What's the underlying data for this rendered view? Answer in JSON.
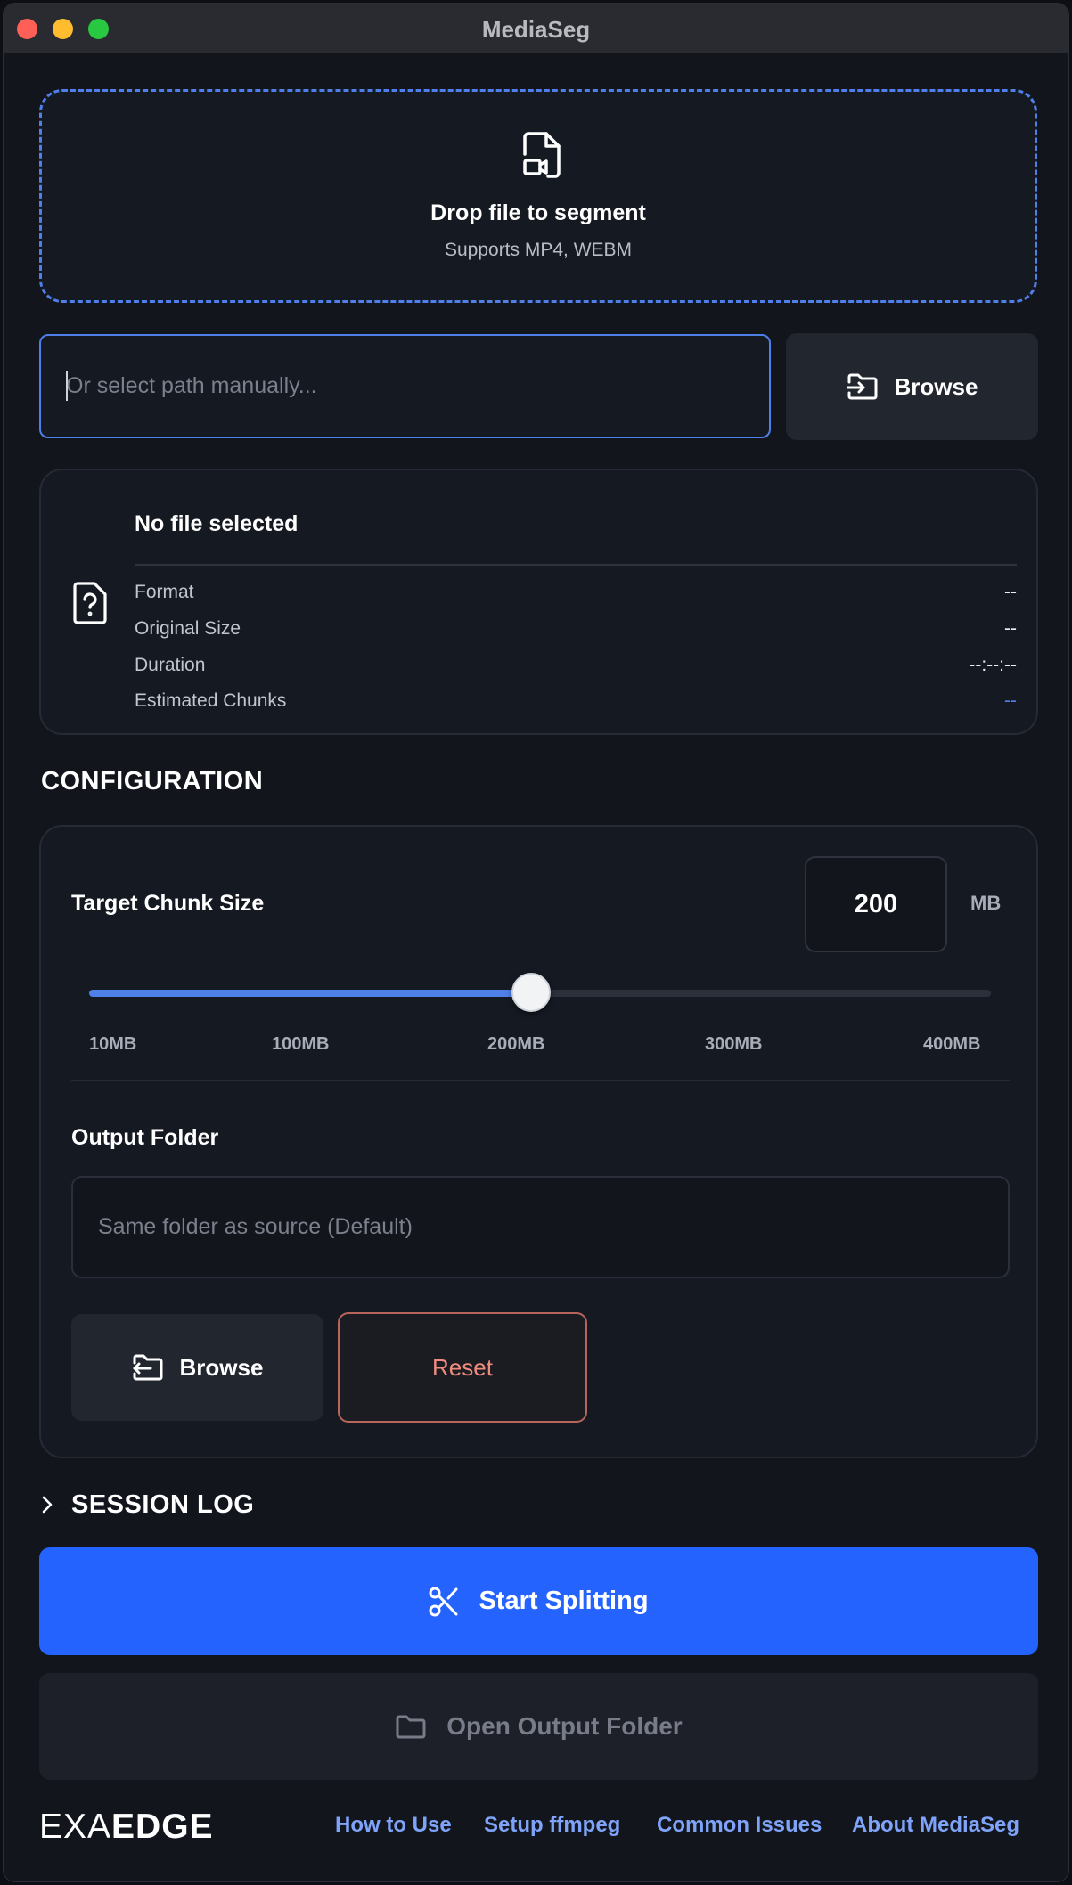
{
  "window": {
    "title": "MediaSeg"
  },
  "dropzone": {
    "title": "Drop file to segment",
    "subtitle": "Supports MP4, WEBM",
    "icon": "file-video-icon"
  },
  "path": {
    "placeholder": "Or select path manually...",
    "value": "",
    "browse_label": "Browse"
  },
  "file_info": {
    "title": "No file selected",
    "icon": "file-question-icon",
    "rows": [
      {
        "label": "Format",
        "value": "--"
      },
      {
        "label": "Original Size",
        "value": "--"
      },
      {
        "label": "Duration",
        "value": "--:--:--"
      },
      {
        "label": "Estimated Chunks",
        "value": "--"
      }
    ]
  },
  "configuration": {
    "title": "CONFIGURATION",
    "chunk_size": {
      "label": "Target Chunk Size",
      "value": "200",
      "unit": "MB",
      "slider": {
        "min_mb": 10,
        "max_mb": 400,
        "value_mb": 200,
        "fill_fraction": 0.49
      },
      "ticks": [
        "10MB",
        "100MB",
        "200MB",
        "300MB",
        "400MB"
      ]
    },
    "output": {
      "label": "Output Folder",
      "placeholder": "Same folder as source (Default)",
      "value": "",
      "browse_label": "Browse",
      "reset_label": "Reset"
    }
  },
  "session_log": {
    "label": "SESSION LOG",
    "expanded": false
  },
  "actions": {
    "start_label": "Start Splitting",
    "open_label": "Open Output Folder"
  },
  "footer": {
    "brand_light": "EXA",
    "brand_bold": "EDGE",
    "links": [
      "How to Use",
      "Setup ffmpeg",
      "Common Issues",
      "About MediaSeg"
    ]
  },
  "colors": {
    "accent": "#4f7fe8",
    "primary_button": "#2563ff",
    "reset_border": "#b7655d",
    "reset_text": "#f08b7f",
    "link": "#7ea3f8"
  }
}
